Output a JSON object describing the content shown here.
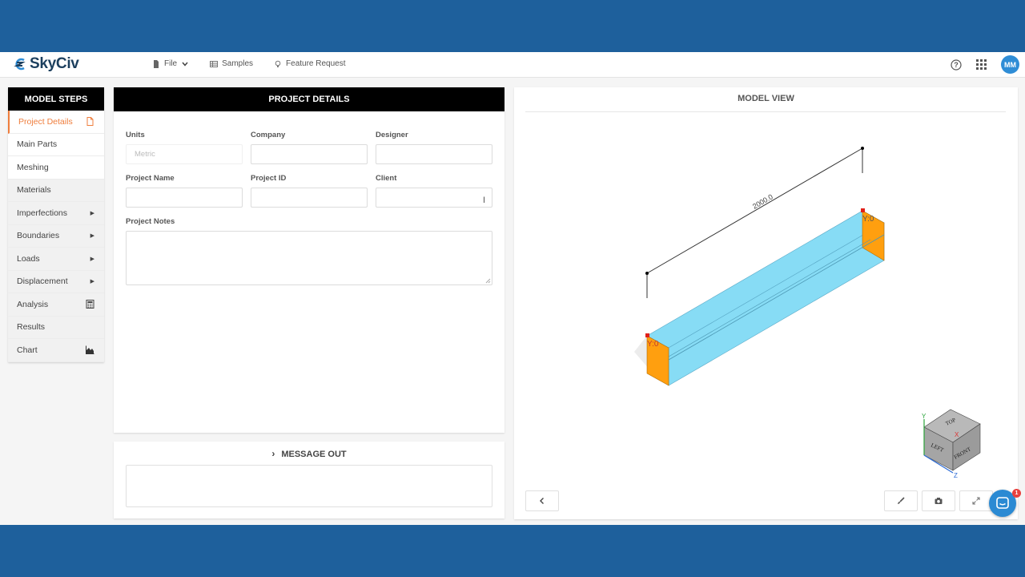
{
  "header": {
    "logo_text": "SkyCiv",
    "nav": [
      {
        "label": "File",
        "icon": "file-icon"
      },
      {
        "label": "Samples",
        "icon": "table-icon"
      },
      {
        "label": "Feature Request",
        "icon": "lightbulb-icon"
      }
    ],
    "avatar_initials": "MM"
  },
  "model_steps": {
    "title": "MODEL STEPS",
    "items": [
      {
        "label": "Project Details"
      },
      {
        "label": "Main Parts"
      },
      {
        "label": "Meshing"
      },
      {
        "label": "Materials"
      },
      {
        "label": "Imperfections"
      },
      {
        "label": "Boundaries"
      },
      {
        "label": "Loads"
      },
      {
        "label": "Displacement"
      },
      {
        "label": "Analysis"
      },
      {
        "label": "Results"
      },
      {
        "label": "Chart"
      }
    ]
  },
  "project_details": {
    "title": "PROJECT DETAILS",
    "units_label": "Units",
    "units_value": "Metric",
    "company_label": "Company",
    "designer_label": "Designer",
    "project_name_label": "Project Name",
    "project_id_label": "Project ID",
    "client_label": "Client",
    "notes_label": "Project Notes"
  },
  "message_out": {
    "title": "MESSAGE OUT"
  },
  "model_view": {
    "title": "MODEL VIEW",
    "dimension_label": "2000.0",
    "support_label_start": "Y:0",
    "support_label_end": "Y:0",
    "cube_faces": {
      "top": "TOP",
      "left": "LEFT",
      "front": "FRONT"
    },
    "axes": {
      "y": "Y",
      "x": "X",
      "z": "Z"
    }
  },
  "chat": {
    "badge_count": "1"
  },
  "colors": {
    "brand_blue": "#1e609c",
    "active_step": "#ef7d3c",
    "beam_face": "#87dcf5",
    "beam_end": "#ff9f0f"
  }
}
